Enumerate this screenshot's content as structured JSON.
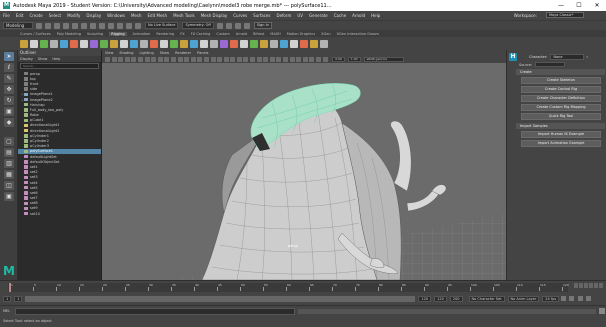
{
  "window": {
    "app_icon": "M",
    "title": "Autodesk Maya 2019 - Student Version: C:\\University\\Advanced modeling\\Caelynn\\model3 robe merge.mb* --- polySurface11...",
    "controls": [
      "minimize-icon",
      "maximize-icon",
      "close-icon"
    ],
    "minimize": "—",
    "maximize": "☐",
    "close": "✕"
  },
  "menubar": {
    "items": [
      "File",
      "Edit",
      "Create",
      "Select",
      "Modify",
      "Display",
      "Windows",
      "Mesh",
      "Edit Mesh",
      "Mesh Tools",
      "Mesh Display",
      "Curves",
      "Surfaces",
      "Deform",
      "UV",
      "Generate",
      "Cache",
      "Arnold",
      "Help"
    ],
    "workspace_label": "Workspace:",
    "workspace_value": "Maya Classic*"
  },
  "statusline": {
    "mode": "Modeling",
    "live_surface": "No Live Surface",
    "symmetry": "Symmetry: Off",
    "sign_in": "Sign In"
  },
  "shelf": {
    "tabs": [
      "Curves / Surfaces",
      "Poly Modeling",
      "Sculpting",
      "Rigging",
      "Animation",
      "Rendering",
      "FX",
      "FX Caching",
      "Custom",
      "Arnold",
      "Bifrost",
      "MASH",
      "Motion Graphics",
      "XGen",
      "XGen Interactive Groom"
    ],
    "active_tab_index": 3,
    "icon_colors": [
      "#c9a23c",
      "#d2d2d2",
      "#66b24f",
      "#b2b2b2",
      "#4fa3d1",
      "#e06a4c",
      "#d2d2d2",
      "#9a6ad4",
      "#66b24f",
      "#c9a23c",
      "#d2d2d2",
      "#4fa3d1",
      "#b2b2b2",
      "#e06a4c",
      "#d2d2d2",
      "#66b24f",
      "#c9a23c",
      "#4fa3d1",
      "#d2d2d2",
      "#b2b2b2",
      "#9a6ad4",
      "#e06a4c",
      "#d2d2d2",
      "#66b24f",
      "#c9a23c",
      "#b2b2b2",
      "#4fa3d1",
      "#d2d2d2",
      "#e06a4c",
      "#c9a23c",
      "#b2b2b2"
    ]
  },
  "toolbox": {
    "tools": [
      "select-tool-icon",
      "lasso-tool-icon",
      "paint-select-icon",
      "move-tool-icon",
      "rotate-tool-icon",
      "scale-tool-icon",
      "last-tool-icon"
    ],
    "glyphs": [
      "➤",
      "ℓ",
      "✎",
      "✥",
      "↻",
      "▣",
      "◆"
    ],
    "layout_glyphs": [
      "▢",
      "▤",
      "▥",
      "▦",
      "◫",
      "▣"
    ],
    "logo": "M"
  },
  "outliner": {
    "title": "Outliner",
    "menu": [
      "Display",
      "Show",
      "Help"
    ],
    "search_placeholder": "Search...",
    "rows": [
      {
        "label": "persp",
        "color": "#7f7f7f",
        "expand": "",
        "sel": false
      },
      {
        "label": "top",
        "color": "#7f7f7f",
        "expand": "",
        "sel": false
      },
      {
        "label": "front",
        "color": "#7f7f7f",
        "expand": "",
        "sel": false
      },
      {
        "label": "side",
        "color": "#7f7f7f",
        "expand": "",
        "sel": false
      },
      {
        "label": "imagePlane1",
        "color": "#8aa6c4",
        "expand": "+",
        "sel": false
      },
      {
        "label": "imagePlane2",
        "color": "#8aa6c4",
        "expand": "+",
        "sel": false
      },
      {
        "label": "Hair/cap",
        "color": "#9fb97f",
        "expand": "",
        "sel": false
      },
      {
        "label": "Full_body_low_poly",
        "color": "#9fb97f",
        "expand": "",
        "sel": false
      },
      {
        "label": "Robe",
        "color": "#9fb97f",
        "expand": "",
        "sel": false
      },
      {
        "label": "pCube1",
        "color": "#9fb97f",
        "expand": "",
        "sel": false
      },
      {
        "label": "directionalLight1",
        "color": "#d9c76a",
        "expand": "",
        "sel": false
      },
      {
        "label": "directionalLight2",
        "color": "#d9c76a",
        "expand": "",
        "sel": false
      },
      {
        "label": "pCylinder1",
        "color": "#9fb97f",
        "expand": "",
        "sel": false
      },
      {
        "label": "pCylinder2",
        "color": "#9fb97f",
        "expand": "",
        "sel": false
      },
      {
        "label": "pCylinder3",
        "color": "#9fb97f",
        "expand": "",
        "sel": false
      },
      {
        "label": "polySurface1",
        "color": "#9fb97f",
        "expand": "",
        "sel": true
      },
      {
        "label": "defaultLightSet",
        "color": "#c48fbf",
        "expand": "",
        "sel": false
      },
      {
        "label": "defaultObjectSet",
        "color": "#c48fbf",
        "expand": "",
        "sel": false
      },
      {
        "label": "set1",
        "color": "#c48fbf",
        "expand": "",
        "sel": false
      },
      {
        "label": "set2",
        "color": "#c48fbf",
        "expand": "",
        "sel": false
      },
      {
        "label": "set3",
        "color": "#c48fbf",
        "expand": "",
        "sel": false
      },
      {
        "label": "set4",
        "color": "#c48fbf",
        "expand": "",
        "sel": false
      },
      {
        "label": "set5",
        "color": "#c48fbf",
        "expand": "",
        "sel": false
      },
      {
        "label": "set6",
        "color": "#c48fbf",
        "expand": "",
        "sel": false
      },
      {
        "label": "set7",
        "color": "#c48fbf",
        "expand": "",
        "sel": false
      },
      {
        "label": "set8",
        "color": "#c48fbf",
        "expand": "",
        "sel": false
      },
      {
        "label": "set9",
        "color": "#c48fbf",
        "expand": "",
        "sel": false
      },
      {
        "label": "set10",
        "color": "#c48fbf",
        "expand": "",
        "sel": false
      }
    ]
  },
  "viewport": {
    "menu": [
      "View",
      "Shading",
      "Lighting",
      "Show",
      "Renderer",
      "Panels"
    ],
    "field1": "0.00",
    "field2": "1.00",
    "colorspace": "sRGB gamma",
    "camera_label": "persp",
    "bg_color": "#6b6b6b",
    "mesh_color": "#cfcfcf",
    "selection_color": "#7fe2b8"
  },
  "hik": {
    "icon": "H",
    "character_label": "Character:",
    "character_value": "None",
    "source_label": "Source:",
    "sections": [
      {
        "label": "Create",
        "buttons": [
          "Create Skeleton",
          "Create Control Rig",
          "Create Character Definition",
          "Create Custom Rig Mapping",
          "Quick Rig Tool"
        ]
      },
      {
        "label": "Import Samples",
        "buttons": [
          "Import Human IK Example",
          "Import Animation Example"
        ]
      }
    ]
  },
  "timeslider": {
    "ticks": [
      "1",
      "5",
      "10",
      "15",
      "20",
      "25",
      "30",
      "35",
      "40",
      "45",
      "50",
      "55",
      "60",
      "65",
      "70",
      "75",
      "80",
      "85",
      "90",
      "95",
      "100",
      "105",
      "110",
      "115",
      "120"
    ],
    "current_frame": "1"
  },
  "rangeslider": {
    "start": "1",
    "start2": "1",
    "end": "120",
    "end2": "120",
    "end3": "200",
    "character_set": "No Character Set",
    "anim_layer": "No Anim Layer",
    "fps": "24 fps"
  },
  "cmdline": {
    "lang": "MEL"
  },
  "helpline": {
    "text": "Select Tool: select an object"
  }
}
